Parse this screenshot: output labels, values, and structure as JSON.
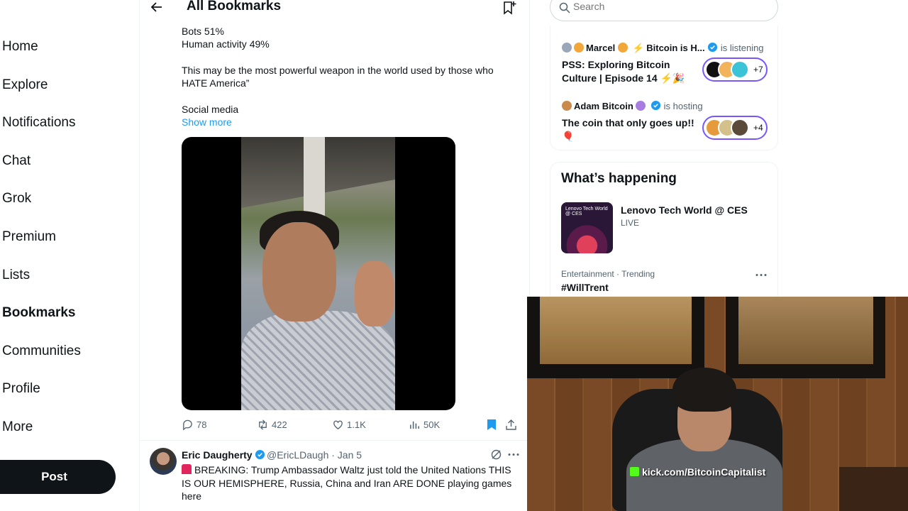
{
  "nav": {
    "items": [
      "Home",
      "Explore",
      "Notifications",
      "Chat",
      "Grok",
      "Premium",
      "Lists",
      "Bookmarks",
      "Communities",
      "Profile",
      "More"
    ],
    "active": "Bookmarks",
    "post_label": "Post"
  },
  "header": {
    "title": "All Bookmarks"
  },
  "tweet1": {
    "line1": "Bots 51%",
    "line2": "Human activity 49%",
    "para2_line1": "This may be the most powerful weapon in the world used by those who",
    "para2_line2": "HATE America”",
    "para3": "Social media",
    "show_more": "Show more",
    "replies": "78",
    "reposts": "422",
    "likes": "1.1K",
    "views": "50K"
  },
  "tweet2": {
    "name": "Eric Daugherty",
    "handle_date": "@EricLDaugh · Jan 5",
    "text": "BREAKING: Trump Ambassador Waltz just told the United Nations THIS IS OUR HEMISPHERE, Russia, China and Iran ARE DONE playing games here"
  },
  "search": {
    "placeholder": "Search"
  },
  "spaces": [
    {
      "host": "Marcel",
      "host_extra": "⚡ Bitcoin is H...",
      "status": "is listening",
      "title": "PSS: Exploring Bitcoin Culture | Episode 14 ⚡🎉",
      "count": "+7"
    },
    {
      "host": "Adam Bitcoin",
      "status": "is hosting",
      "title": "The coin that only goes up!! 🎈",
      "count": "+4"
    }
  ],
  "happening": {
    "title": "What’s happening",
    "trend1": {
      "title": "Lenovo Tech World @ CES",
      "sub": "LIVE",
      "thumb_text": "Lenovo Tech World @ CES"
    },
    "trend2": {
      "category": "Entertainment · Trending",
      "title": "#WillTrent"
    }
  },
  "webcam": {
    "watermark": "kick.com/BitcoinCapitalist"
  },
  "colors": {
    "accent": "#1d9bf0",
    "spaces_border": "#7856ff",
    "kick_green": "#53fc18"
  }
}
